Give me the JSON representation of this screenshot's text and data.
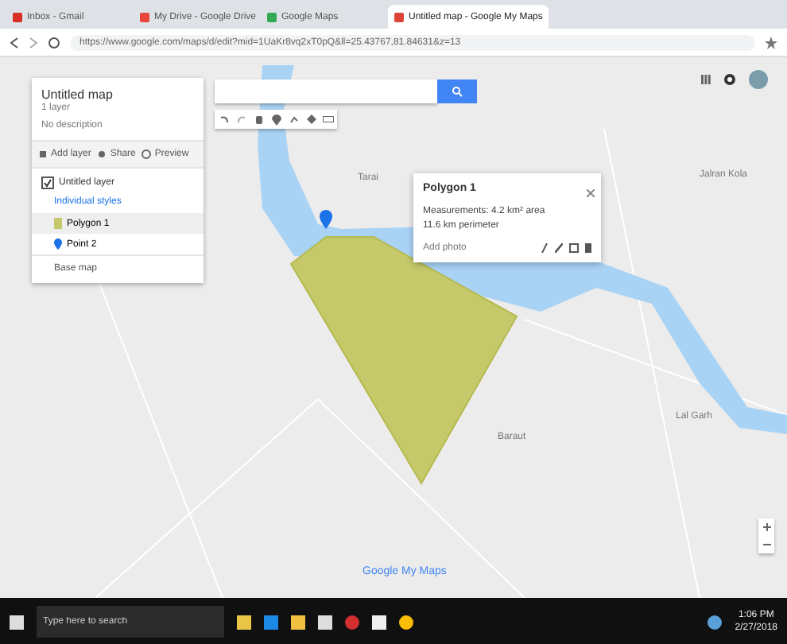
{
  "browser": {
    "tabs": [
      {
        "label": "Inbox - Gmail",
        "selected": false,
        "color": "#d93025"
      },
      {
        "label": "My Drive - Google Drive",
        "selected": false,
        "color": "#e8453c"
      },
      {
        "label": "Google Maps",
        "selected": false,
        "color": "#34a853"
      },
      {
        "label": "Untitled map - Google My Maps",
        "selected": true,
        "color": "#db4437"
      }
    ],
    "url": "https://www.google.com/maps/d/edit?mid=1UaKr8vq2xT0pQ&ll=25.43767,81.84631&z=13"
  },
  "map_panel": {
    "title": "Untitled map",
    "subtitle": "1 layer",
    "description": "No description",
    "actions": [
      {
        "kind": "add-layer",
        "label": "Add layer"
      },
      {
        "kind": "share",
        "label": "Share"
      },
      {
        "kind": "preview",
        "label": "Preview"
      }
    ],
    "layer": {
      "name": "Untitled layer",
      "checked": true,
      "style": "Individual styles",
      "features": [
        {
          "kind": "polygon",
          "label": "Polygon 1",
          "selected": true,
          "color": "#c5c96a"
        },
        {
          "kind": "pin",
          "label": "Point 2",
          "selected": false,
          "color": "#1a73e8"
        }
      ]
    },
    "base_map": "Base map"
  },
  "popup": {
    "title": "Polygon 1",
    "lines": [
      "Measurements: 4.2 km² area",
      "11.6 km perimeter"
    ],
    "footer": "Add photo"
  },
  "map_labels": [
    "Jalran Kola",
    "Tarai",
    "Baraut",
    "Lal Garh",
    "Google My Maps"
  ],
  "taskbar": {
    "search_placeholder": "Type here to search",
    "time": "1:06 PM",
    "date": "2/27/2018"
  }
}
